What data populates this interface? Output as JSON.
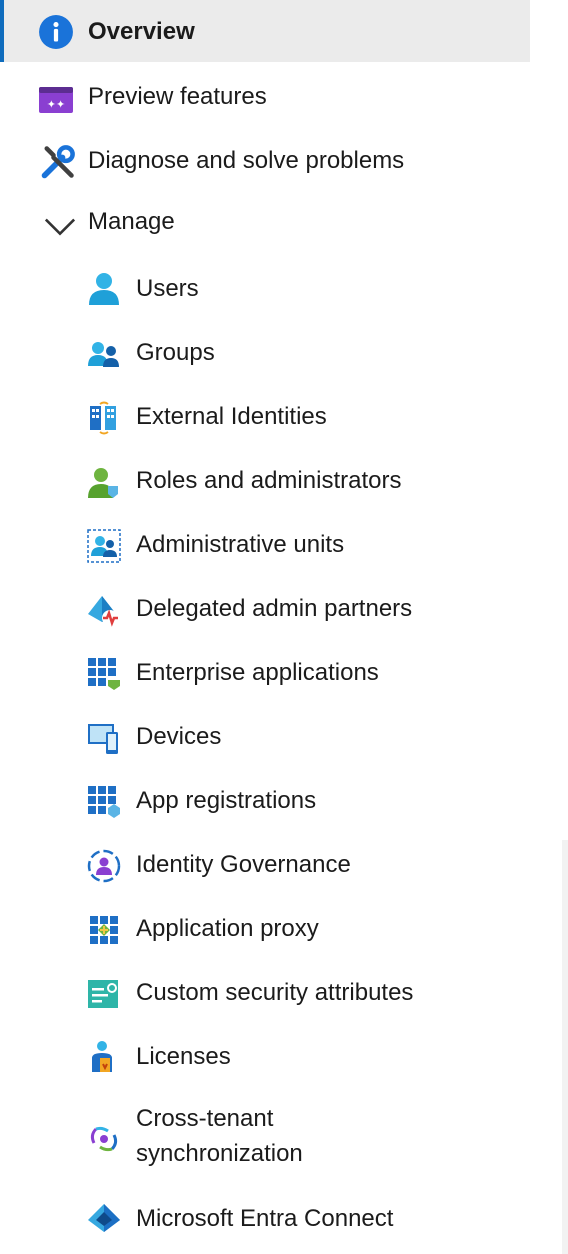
{
  "nav": {
    "overview": {
      "label": "Overview",
      "icon": "info-icon"
    },
    "preview": {
      "label": "Preview features",
      "icon": "preview-icon"
    },
    "diagnose": {
      "label": "Diagnose and solve problems",
      "icon": "wrench-icon"
    },
    "manage": {
      "label": "Manage",
      "icon": "chevron-down-icon"
    },
    "items": [
      {
        "label": "Users",
        "icon": "user-icon"
      },
      {
        "label": "Groups",
        "icon": "groups-icon"
      },
      {
        "label": "External Identities",
        "icon": "external-identities-icon"
      },
      {
        "label": "Roles and administrators",
        "icon": "roles-icon"
      },
      {
        "label": "Administrative units",
        "icon": "admin-units-icon"
      },
      {
        "label": "Delegated admin partners",
        "icon": "delegated-admin-icon"
      },
      {
        "label": "Enterprise applications",
        "icon": "enterprise-apps-icon"
      },
      {
        "label": "Devices",
        "icon": "devices-icon"
      },
      {
        "label": "App registrations",
        "icon": "app-registrations-icon"
      },
      {
        "label": "Identity Governance",
        "icon": "identity-governance-icon"
      },
      {
        "label": "Application proxy",
        "icon": "application-proxy-icon"
      },
      {
        "label": "Custom security attributes",
        "icon": "custom-security-icon"
      },
      {
        "label": "Licenses",
        "icon": "licenses-icon"
      },
      {
        "label_line1": "Cross-tenant",
        "label_line2": "synchronization",
        "icon": "cross-tenant-icon"
      },
      {
        "label": "Microsoft Entra Connect",
        "icon": "entra-connect-icon"
      }
    ]
  },
  "colors": {
    "accent": "#0f6cbd",
    "selected_bg": "#ebebeb",
    "text": "#1b1b1b"
  }
}
